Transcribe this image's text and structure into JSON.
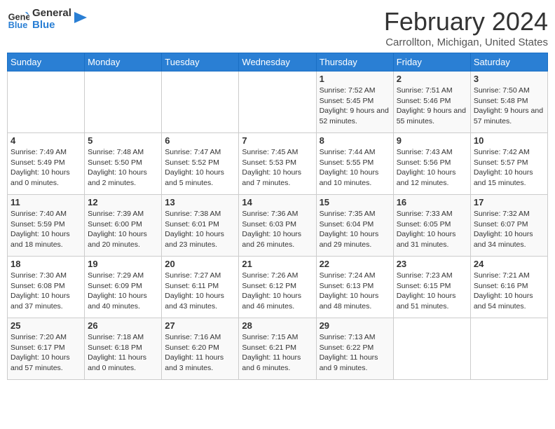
{
  "header": {
    "logo_line1": "General",
    "logo_line2": "Blue",
    "month": "February 2024",
    "location": "Carrollton, Michigan, United States"
  },
  "days_of_week": [
    "Sunday",
    "Monday",
    "Tuesday",
    "Wednesday",
    "Thursday",
    "Friday",
    "Saturday"
  ],
  "weeks": [
    [
      {
        "day": "",
        "info": ""
      },
      {
        "day": "",
        "info": ""
      },
      {
        "day": "",
        "info": ""
      },
      {
        "day": "",
        "info": ""
      },
      {
        "day": "1",
        "info": "Sunrise: 7:52 AM\nSunset: 5:45 PM\nDaylight: 9 hours and 52 minutes."
      },
      {
        "day": "2",
        "info": "Sunrise: 7:51 AM\nSunset: 5:46 PM\nDaylight: 9 hours and 55 minutes."
      },
      {
        "day": "3",
        "info": "Sunrise: 7:50 AM\nSunset: 5:48 PM\nDaylight: 9 hours and 57 minutes."
      }
    ],
    [
      {
        "day": "4",
        "info": "Sunrise: 7:49 AM\nSunset: 5:49 PM\nDaylight: 10 hours and 0 minutes."
      },
      {
        "day": "5",
        "info": "Sunrise: 7:48 AM\nSunset: 5:50 PM\nDaylight: 10 hours and 2 minutes."
      },
      {
        "day": "6",
        "info": "Sunrise: 7:47 AM\nSunset: 5:52 PM\nDaylight: 10 hours and 5 minutes."
      },
      {
        "day": "7",
        "info": "Sunrise: 7:45 AM\nSunset: 5:53 PM\nDaylight: 10 hours and 7 minutes."
      },
      {
        "day": "8",
        "info": "Sunrise: 7:44 AM\nSunset: 5:55 PM\nDaylight: 10 hours and 10 minutes."
      },
      {
        "day": "9",
        "info": "Sunrise: 7:43 AM\nSunset: 5:56 PM\nDaylight: 10 hours and 12 minutes."
      },
      {
        "day": "10",
        "info": "Sunrise: 7:42 AM\nSunset: 5:57 PM\nDaylight: 10 hours and 15 minutes."
      }
    ],
    [
      {
        "day": "11",
        "info": "Sunrise: 7:40 AM\nSunset: 5:59 PM\nDaylight: 10 hours and 18 minutes."
      },
      {
        "day": "12",
        "info": "Sunrise: 7:39 AM\nSunset: 6:00 PM\nDaylight: 10 hours and 20 minutes."
      },
      {
        "day": "13",
        "info": "Sunrise: 7:38 AM\nSunset: 6:01 PM\nDaylight: 10 hours and 23 minutes."
      },
      {
        "day": "14",
        "info": "Sunrise: 7:36 AM\nSunset: 6:03 PM\nDaylight: 10 hours and 26 minutes."
      },
      {
        "day": "15",
        "info": "Sunrise: 7:35 AM\nSunset: 6:04 PM\nDaylight: 10 hours and 29 minutes."
      },
      {
        "day": "16",
        "info": "Sunrise: 7:33 AM\nSunset: 6:05 PM\nDaylight: 10 hours and 31 minutes."
      },
      {
        "day": "17",
        "info": "Sunrise: 7:32 AM\nSunset: 6:07 PM\nDaylight: 10 hours and 34 minutes."
      }
    ],
    [
      {
        "day": "18",
        "info": "Sunrise: 7:30 AM\nSunset: 6:08 PM\nDaylight: 10 hours and 37 minutes."
      },
      {
        "day": "19",
        "info": "Sunrise: 7:29 AM\nSunset: 6:09 PM\nDaylight: 10 hours and 40 minutes."
      },
      {
        "day": "20",
        "info": "Sunrise: 7:27 AM\nSunset: 6:11 PM\nDaylight: 10 hours and 43 minutes."
      },
      {
        "day": "21",
        "info": "Sunrise: 7:26 AM\nSunset: 6:12 PM\nDaylight: 10 hours and 46 minutes."
      },
      {
        "day": "22",
        "info": "Sunrise: 7:24 AM\nSunset: 6:13 PM\nDaylight: 10 hours and 48 minutes."
      },
      {
        "day": "23",
        "info": "Sunrise: 7:23 AM\nSunset: 6:15 PM\nDaylight: 10 hours and 51 minutes."
      },
      {
        "day": "24",
        "info": "Sunrise: 7:21 AM\nSunset: 6:16 PM\nDaylight: 10 hours and 54 minutes."
      }
    ],
    [
      {
        "day": "25",
        "info": "Sunrise: 7:20 AM\nSunset: 6:17 PM\nDaylight: 10 hours and 57 minutes."
      },
      {
        "day": "26",
        "info": "Sunrise: 7:18 AM\nSunset: 6:18 PM\nDaylight: 11 hours and 0 minutes."
      },
      {
        "day": "27",
        "info": "Sunrise: 7:16 AM\nSunset: 6:20 PM\nDaylight: 11 hours and 3 minutes."
      },
      {
        "day": "28",
        "info": "Sunrise: 7:15 AM\nSunset: 6:21 PM\nDaylight: 11 hours and 6 minutes."
      },
      {
        "day": "29",
        "info": "Sunrise: 7:13 AM\nSunset: 6:22 PM\nDaylight: 11 hours and 9 minutes."
      },
      {
        "day": "",
        "info": ""
      },
      {
        "day": "",
        "info": ""
      }
    ]
  ]
}
